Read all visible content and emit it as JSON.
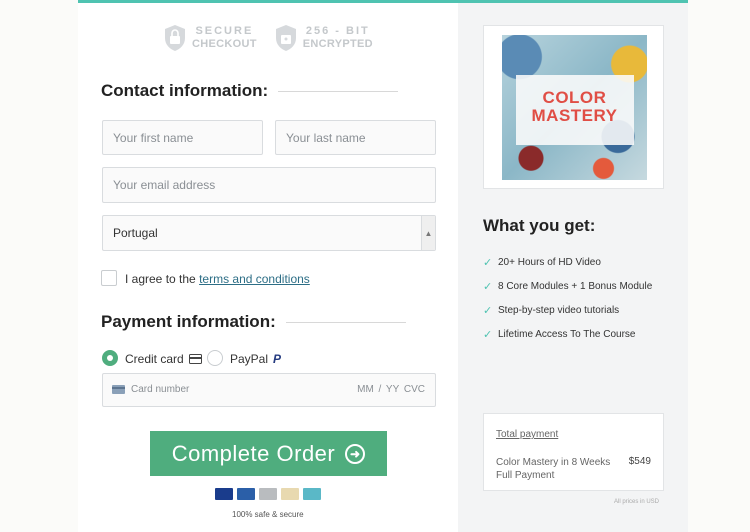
{
  "badges": {
    "secure": {
      "line1": "SECURE",
      "line2": "CHECKOUT"
    },
    "encrypted": {
      "line1": "256 - BIT",
      "line2": "ENCRYPTED"
    }
  },
  "contact": {
    "title": "Contact information:",
    "first_name_placeholder": "Your first name",
    "last_name_placeholder": "Your last name",
    "email_placeholder": "Your email address",
    "country": "Portugal"
  },
  "agree": {
    "prefix": "I agree to the ",
    "link": "terms and conditions"
  },
  "payment": {
    "title": "Payment information:",
    "options": [
      {
        "label": "Credit card",
        "selected": true
      },
      {
        "label": "PayPal",
        "selected": false
      }
    ],
    "card_number_placeholder": "Card number",
    "expiry_placeholder": "MM / YY",
    "cvc_placeholder": "CVC"
  },
  "order_button": "Complete Order",
  "card_brands": [
    {
      "name": "VISA",
      "color": "#1a3c8c"
    },
    {
      "name": "mastercard",
      "color": "#2b5fa8"
    },
    {
      "name": "generic",
      "color": "#b9bcbf"
    },
    {
      "name": "discover",
      "color": "#e8d9b0"
    },
    {
      "name": "bancontact",
      "color": "#5ab8c7"
    }
  ],
  "safe_text": "100% safe & secure",
  "product": {
    "title_line1": "COLOR",
    "title_line2": "MASTERY"
  },
  "what_you_get": {
    "title": "What you get:",
    "items": [
      "20+ Hours of HD Video",
      "8 Core Modules + 1 Bonus Module",
      "Step-by-step video tutorials",
      "Lifetime Access To The Course"
    ]
  },
  "summary": {
    "label": "Total payment",
    "item": "Color Mastery in 8 Weeks Full Payment",
    "price": "$549",
    "note": "All prices in USD"
  },
  "colors": {
    "accent": "#4fad7e",
    "topbar": "#4fc3b1",
    "link": "#2d6e86",
    "product_title": "#e04e45"
  }
}
